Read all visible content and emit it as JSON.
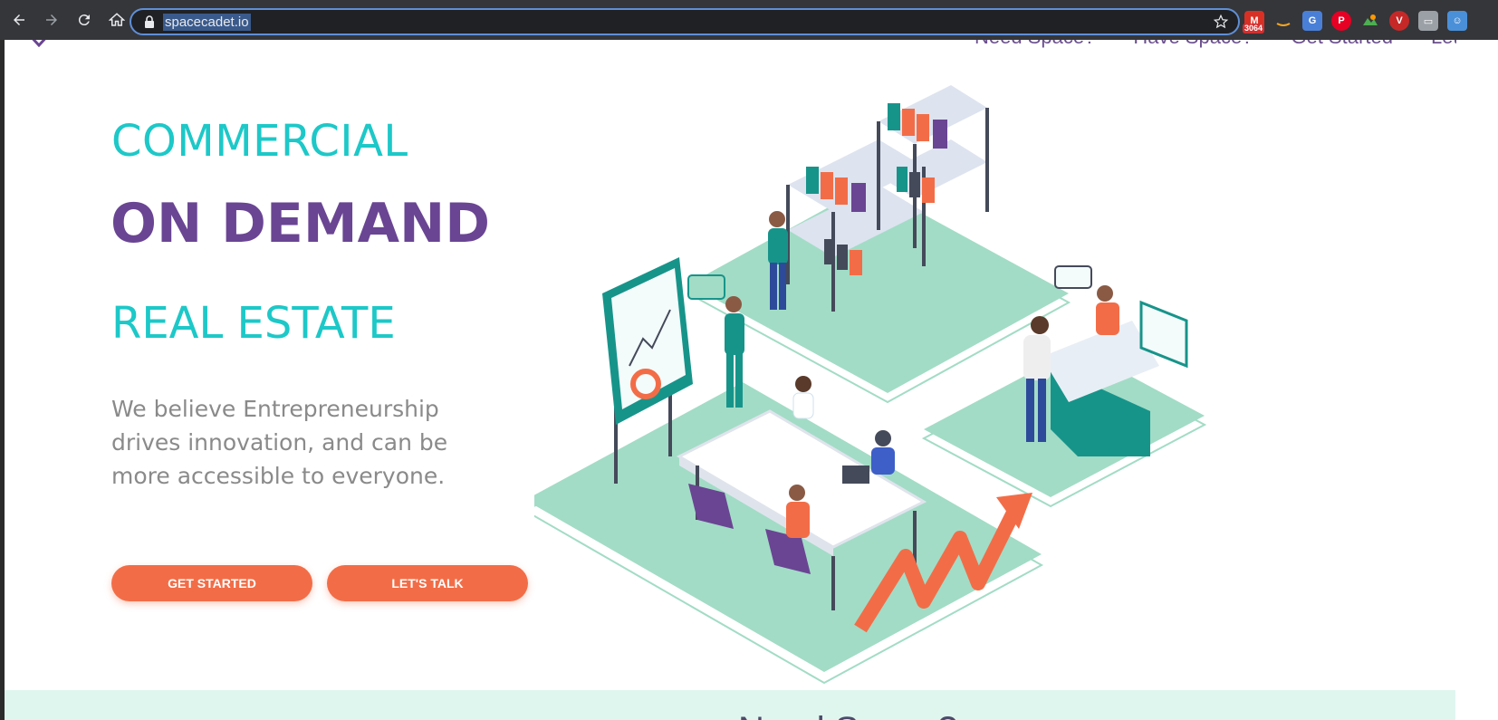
{
  "browser": {
    "url": "spacecadet.io",
    "extensions": [
      {
        "name": "gmail-icon",
        "color": "#d93025",
        "badge": "3064"
      },
      {
        "name": "amazon-icon",
        "color": "#35363a",
        "badge": ""
      },
      {
        "name": "translate-icon",
        "color": "#4a7fd8",
        "badge": ""
      },
      {
        "name": "pinterest-icon",
        "color": "#e60023",
        "badge": ""
      },
      {
        "name": "colorful-icon",
        "color": "#35363a",
        "badge": ""
      },
      {
        "name": "v-icon",
        "color": "#c62828",
        "badge": ""
      },
      {
        "name": "window-icon",
        "color": "#9aa0a6",
        "badge": ""
      },
      {
        "name": "person-icon",
        "color": "#4a90d9",
        "badge": ""
      }
    ]
  },
  "nav": {
    "items": [
      "Need Space?",
      "Have Space?",
      "Get Started",
      "Let's Talk"
    ]
  },
  "hero": {
    "line1": "COMMERCIAL",
    "line2": "ON DEMAND",
    "line3": "REAL ESTATE",
    "tagline": "We believe Entrepreneurship drives innovation, and can be more accessible to everyone.",
    "primary_button": "GET STARTED",
    "secondary_button": "LET'S TALK"
  },
  "colors": {
    "teal": "#1dc8c8",
    "purple": "#6a4593",
    "orange": "#f26d47",
    "mint": "#a2dcc6"
  },
  "footer_band": {
    "heading_fragment": "Need Space?"
  }
}
